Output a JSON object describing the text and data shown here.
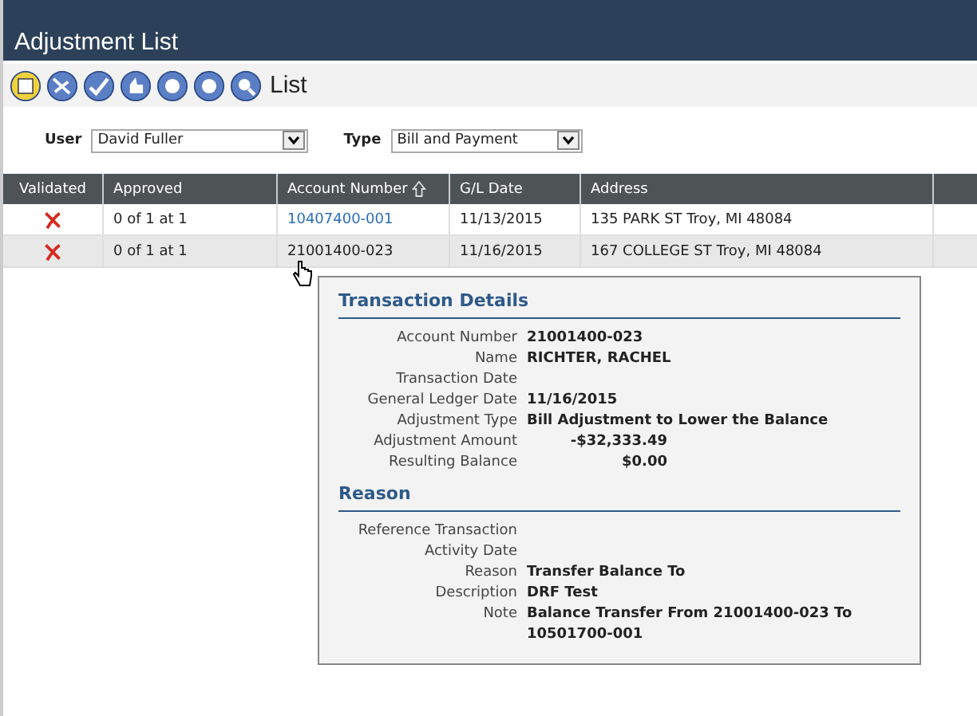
{
  "window": {
    "title": "Adjustment List"
  },
  "toolbar": {
    "label": "List"
  },
  "filters": [
    {
      "label": "User",
      "value": "David Fuller"
    },
    {
      "label": "Type",
      "value": "Bill and Payment"
    }
  ],
  "table": {
    "columns": [
      {
        "label": "Validated",
        "sorted": false
      },
      {
        "label": "Approved",
        "sorted": false
      },
      {
        "label": "Account Number",
        "sorted": true
      },
      {
        "label": "G/L Date",
        "sorted": false
      },
      {
        "label": "Address",
        "sorted": false
      }
    ],
    "rows": [
      {
        "validated": false,
        "approved": "0 of 1 at 1",
        "account": "10407400-001",
        "gl_date": "11/13/2015",
        "address": "135 PARK ST Troy, MI 48084",
        "selected": false
      },
      {
        "validated": false,
        "approved": "0 of 1 at 1",
        "account": "21001400-023",
        "gl_date": "11/16/2015",
        "address": "167 COLLEGE ST Troy, MI 48084",
        "selected": true
      }
    ]
  },
  "popup": {
    "sections": [
      {
        "title": "Transaction Details",
        "fields": [
          {
            "label": "Account Number",
            "value": "21001400-023",
            "kind": "text"
          },
          {
            "label": "Name",
            "value": "RICHTER, RACHEL",
            "kind": "text"
          },
          {
            "label": "Transaction Date"
          },
          {
            "label": "General Ledger Date",
            "value": "11/16/2015",
            "kind": "text"
          },
          {
            "label": "Adjustment Type",
            "value": "Bill Adjustment to Lower the Balance",
            "kind": "text"
          },
          {
            "label": "Adjustment Amount",
            "value": "-$32,333.49",
            "kind": "amount"
          },
          {
            "label": "Resulting Balance",
            "value": "$0.00",
            "kind": "amount"
          }
        ]
      },
      {
        "title": "Reason",
        "fields": [
          {
            "label": "Reference Transaction"
          },
          {
            "label": "Activity Date"
          },
          {
            "label": "Reason",
            "value": "Transfer Balance To",
            "kind": "text"
          },
          {
            "label": "Description",
            "value": "DRF Test",
            "kind": "text"
          },
          {
            "label": "Note",
            "value": "Balance Transfer From 21001400-023 To 10501700-001",
            "kind": "text"
          }
        ]
      }
    ]
  }
}
